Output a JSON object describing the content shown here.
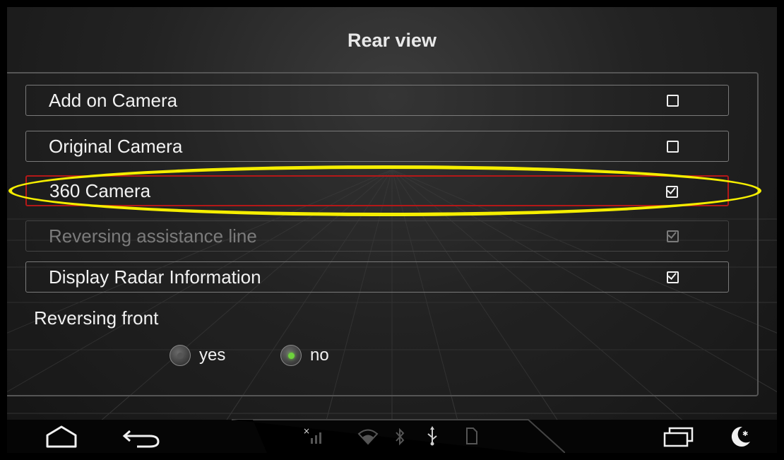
{
  "header": {
    "title": "Rear view"
  },
  "options": [
    {
      "label": "Add on Camera",
      "checked": false,
      "state": "normal"
    },
    {
      "label": "Original Camera",
      "checked": false,
      "state": "normal"
    },
    {
      "label": "360 Camera",
      "checked": true,
      "state": "selected"
    },
    {
      "label": "Reversing assistance line",
      "checked": true,
      "state": "disabled"
    },
    {
      "label": "Display Radar Information",
      "checked": true,
      "state": "normal"
    }
  ],
  "reversing_front": {
    "label": "Reversing front",
    "options": [
      {
        "label": "yes",
        "selected": false
      },
      {
        "label": "no",
        "selected": true
      }
    ]
  },
  "navbar": {
    "left_icons": [
      "home-icon",
      "back-icon"
    ],
    "status_icons": [
      "signal-off-icon",
      "wifi-icon",
      "bluetooth-icon",
      "usb-icon",
      "sd-card-icon"
    ],
    "right_icons": [
      "recent-apps-icon",
      "night-mode-icon"
    ]
  },
  "colors": {
    "highlight_annotation": "#f5ee00",
    "selected_border": "#b41818",
    "radio_active": "#6ed23c"
  }
}
